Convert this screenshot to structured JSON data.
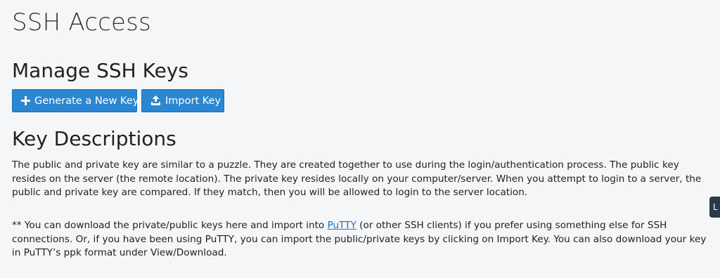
{
  "page": {
    "title": "SSH Access"
  },
  "manage": {
    "heading": "Manage SSH Keys",
    "generate_button": {
      "label": "Generate a New Key",
      "icon": "plus-icon"
    },
    "import_button": {
      "label": "Import Key",
      "icon": "upload-icon"
    }
  },
  "descriptions": {
    "heading": "Key Descriptions",
    "paragraph1": "The public and private key are similar to a puzzle. They are created together to use during the login/authentication process. The public key resides on the server (the remote location). The private key resides locally on your computer/server. When you attempt to login to a server, the public and private key are compared. If they match, then you will be allowed to login to the server location.",
    "paragraph2_before": "** You can download the private/public keys here and import into ",
    "paragraph2_link": "PuTTY",
    "paragraph2_after": " (or other SSH clients) if you prefer using something else for SSH connections. Or, if you have been using PuTTY, you can import the public/private keys by clicking on Import Key. You can also download your key in PuTTY’s ppk format under View/Download."
  },
  "side_tab": {
    "label": "L"
  },
  "colors": {
    "background": "#f5f6f8",
    "button": "#2c87d3",
    "link": "#1d73c9",
    "side_tab": "#2a3a4a"
  }
}
